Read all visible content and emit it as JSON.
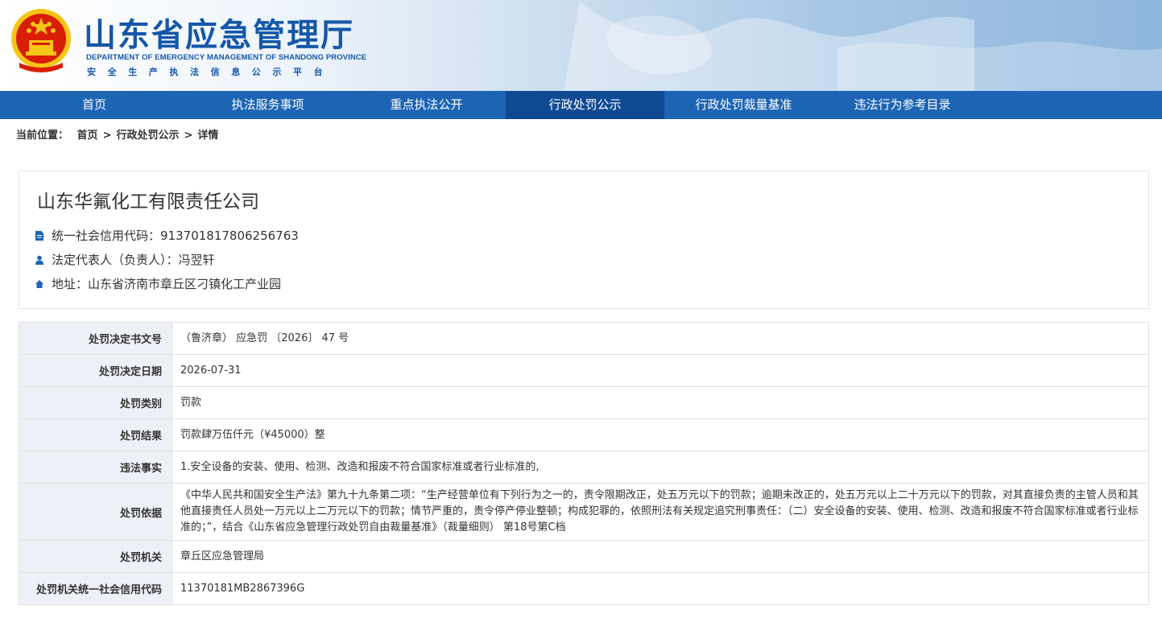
{
  "header": {
    "title": "山东省应急管理厅",
    "title_en": "DEPARTMENT OF EMERGENCY MANAGEMENT OF SHANDONG PROVINCE",
    "subtitle": "安全生产执法信息公示平台"
  },
  "nav": {
    "items": [
      {
        "label": "首页"
      },
      {
        "label": "执法服务事项"
      },
      {
        "label": "重点执法公开"
      },
      {
        "label": "行政处罚公示",
        "active": true
      },
      {
        "label": "行政处罚裁量基准"
      },
      {
        "label": "违法行为参考目录"
      }
    ]
  },
  "breadcrumb": {
    "prefix": "当前位置：",
    "items": [
      "首页",
      "行政处罚公示",
      "详情"
    ],
    "separator": ">"
  },
  "company": {
    "name": "山东华氟化工有限责任公司",
    "credit_code_label": "统一社会信用代码：",
    "credit_code": "913701817806256763",
    "legal_rep_label": "法定代表人（负责人）：",
    "legal_rep": "冯翌轩",
    "address_label": "地址：",
    "address": "山东省济南市章丘区刁镇化工产业园"
  },
  "details": [
    {
      "key": "处罚决定书文号",
      "value": "（鲁济章） 应急罚 〔2026〕 47 号"
    },
    {
      "key": "处罚决定日期",
      "value": "2026-07-31"
    },
    {
      "key": "处罚类别",
      "value": "罚款"
    },
    {
      "key": "处罚结果",
      "value": "罚款肆万伍仟元（¥45000）整"
    },
    {
      "key": "违法事实",
      "value": "1.安全设备的安装、使用、检测、改造和报废不符合国家标准或者行业标准的,"
    },
    {
      "key": "处罚依据",
      "value": "《中华人民共和国安全生产法》第九十九条第二项：“生产经营单位有下列行为之一的，责令限期改正，处五万元以下的罚款；逾期未改正的，处五万元以上二十万元以下的罚款，对其直接负责的主管人员和其他直接责任人员处一万元以上二万元以下的罚款；情节严重的，责令停产停业整顿；构成犯罪的，依照刑法有关规定追究刑事责任：（二）安全设备的安装、使用、检测、改造和报废不符合国家标准或者行业标准的；”，结合《山东省应急管理行政处罚自由裁量基准》（裁量细则） 第18号第C档"
    },
    {
      "key": "处罚机关",
      "value": "章丘区应急管理局"
    },
    {
      "key": "处罚机关统一社会信用代码",
      "value": "11370181MB2867396G"
    }
  ],
  "colors": {
    "brand_blue": "#1d64b4",
    "nav_active": "#0f4a93",
    "title_blue": "#1557a8",
    "emblem_red": "#d81e06",
    "emblem_gold": "#f5c518",
    "label_bg": "#eef0f7"
  }
}
